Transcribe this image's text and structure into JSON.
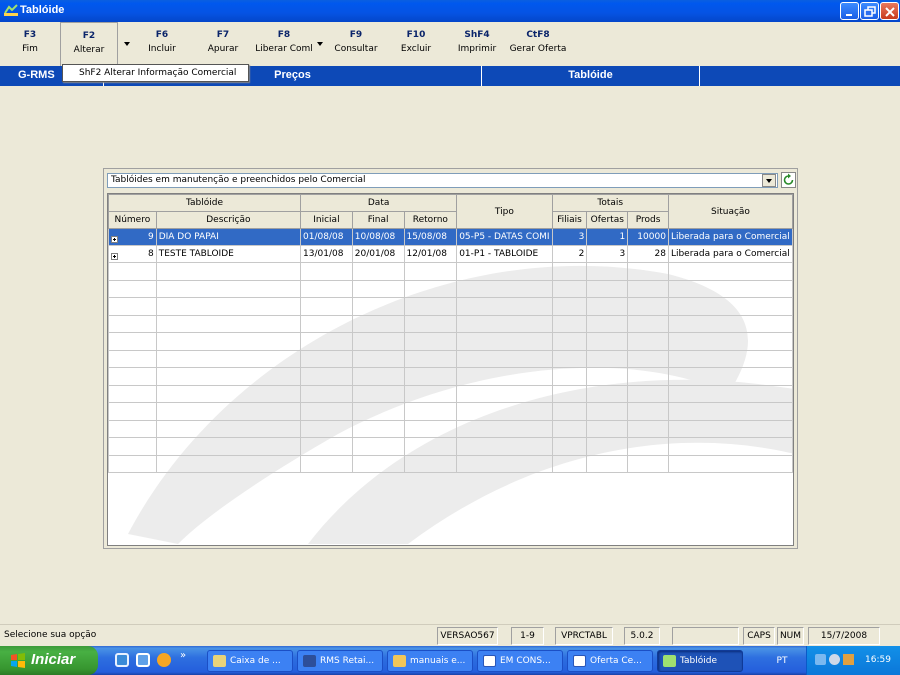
{
  "window": {
    "title": "Tablóide"
  },
  "toolbar": [
    {
      "key": "F3",
      "label": "Fim"
    },
    {
      "key": "F2",
      "label": "Alterar"
    },
    {
      "key": "F6",
      "label": "Incluir"
    },
    {
      "key": "F7",
      "label": "Apurar"
    },
    {
      "key": "F8",
      "label": "Liberar Coml"
    },
    {
      "key": "F9",
      "label": "Consultar"
    },
    {
      "key": "F10",
      "label": "Excluir"
    },
    {
      "key": "ShF4",
      "label": "Imprimir"
    },
    {
      "key": "CtF8",
      "label": "Gerar Oferta"
    }
  ],
  "dropdown": {
    "item": "ShF2  Alterar Informação Comercial"
  },
  "nav": {
    "left": "G-RMS",
    "middle": "Preços",
    "right": "Tablóide"
  },
  "filter": {
    "value": "Tablóides em manutenção e preenchidos pelo Comercial"
  },
  "grid": {
    "groups": {
      "tabloide": "Tablóide",
      "data": "Data",
      "tipo": "Tipo",
      "totais": "Totais",
      "situacao": "Situação"
    },
    "cols": {
      "numero": "Número",
      "descricao": "Descrição",
      "inicial": "Inicial",
      "final": "Final",
      "retorno": "Retorno",
      "filiais": "Filiais",
      "ofertas": "Ofertas",
      "prods": "Prods"
    },
    "rows": [
      {
        "numero": "9",
        "descricao": "DIA DO PAPAI",
        "inicial": "01/08/08",
        "final": "10/08/08",
        "retorno": "15/08/08",
        "tipo": "05-P5 - DATAS COMI",
        "filiais": "3",
        "ofertas": "1",
        "prods": "10000",
        "situacao": "Liberada para o Comercial"
      },
      {
        "numero": "8",
        "descricao": "TESTE TABLOIDE",
        "inicial": "13/01/08",
        "final": "20/01/08",
        "retorno": "12/01/08",
        "tipo": "01-P1 - TABLOIDE",
        "filiais": "2",
        "ofertas": "3",
        "prods": "28",
        "situacao": "Liberada para o Comercial"
      }
    ]
  },
  "status": {
    "message": "Selecione sua opção",
    "version": "VERSAO567",
    "range": "1-9",
    "program": "VPRCTABL",
    "release": "5.0.2",
    "caps": "CAPS",
    "num": "NUM",
    "date": "15/7/2008"
  },
  "taskbar": {
    "start": "Iniciar",
    "chevron": "»",
    "tasks": [
      "Caixa de ...",
      "RMS Retai...",
      "manuais e...",
      "EM CONS...",
      "Oferta Ce...",
      "Tablóide"
    ],
    "lang": "PT",
    "clock": "16:59"
  }
}
